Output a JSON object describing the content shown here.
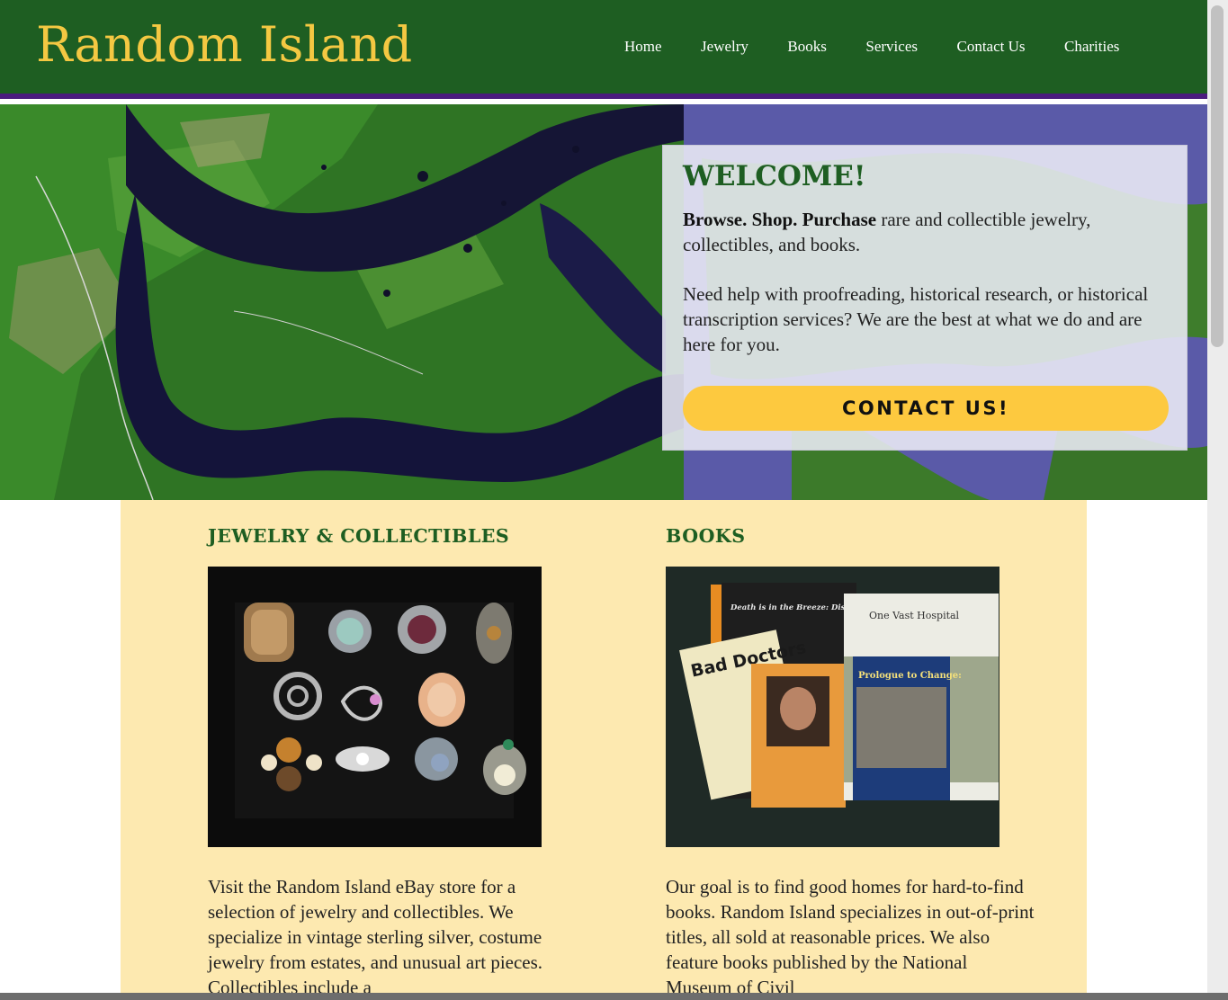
{
  "header": {
    "site_title": "Random Island",
    "nav": [
      "Home",
      "Jewelry",
      "Books",
      "Services",
      "Contact Us",
      "Charities"
    ]
  },
  "hero": {
    "welcome_title": "WELCOME!",
    "intro_bold": "Browse. Shop. Purchase",
    "intro_rest": " rare and collectible jewelry, collectibles, and books.",
    "services_text": "Need help with proofreading, historical research, or historical transcription services? We are the best at what we do and are here for you.",
    "cta_label": "CONTACT US!"
  },
  "sections": {
    "jewelry": {
      "heading": "JEWELRY & COLLECTIBLES",
      "photo_icon": "rings-photo",
      "text": "Visit the Random Island eBay store for a selection of jewelry and collectibles. We specialize in vintage sterling silver, costume jewelry from estates, and unusual art pieces. Collectibles include a"
    },
    "books": {
      "heading": "BOOKS",
      "photo_icon": "books-photo",
      "text": "Our goal is to find good homes for hard-to-find books. Random Island specializes in out-of-print titles, all sold at reasonable prices. We also feature books published by the National Museum of Civil",
      "book_titles": [
        "Death is in the Breeze: Disease during the American Civil War",
        "Bad Doctors",
        "One Vast Hospital",
        "Prologue to Change:"
      ]
    }
  },
  "colors": {
    "header_green": "#1e5e22",
    "title_gold": "#f4c842",
    "accent_purple": "#4b1b7e",
    "cta_yellow": "#fdc93f",
    "content_cream": "#fde9b0"
  }
}
